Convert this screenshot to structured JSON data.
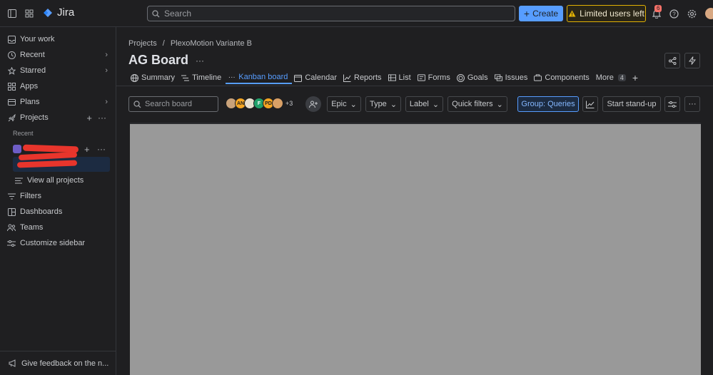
{
  "topbar": {
    "app_name": "Jira",
    "search_placeholder": "Search",
    "create_label": "Create",
    "limited_label": "Limited users left",
    "notification_count": "6"
  },
  "sidebar": {
    "items": [
      {
        "label": "Your work",
        "icon": "inbox-icon"
      },
      {
        "label": "Recent",
        "icon": "clock-icon"
      },
      {
        "label": "Starred",
        "icon": "star-icon"
      },
      {
        "label": "Apps",
        "icon": "apps-icon"
      },
      {
        "label": "Plans",
        "icon": "plans-icon"
      },
      {
        "label": "Projects",
        "icon": "rocket-icon"
      }
    ],
    "recent_heading": "Recent",
    "view_all_projects": "View all projects",
    "filters": "Filters",
    "dashboards": "Dashboards",
    "teams": "Teams",
    "customize": "Customize sidebar",
    "feedback": "Give feedback on the n..."
  },
  "main": {
    "breadcrumb": [
      "Projects",
      "/",
      "PlexoMotion Variante B"
    ],
    "title": "AG Board",
    "tabs": [
      {
        "label": "Summary",
        "icon": "globe-icon"
      },
      {
        "label": "Timeline",
        "icon": "timeline-icon"
      },
      {
        "label": "Kanban board",
        "icon": "dots-icon",
        "active": true
      },
      {
        "label": "Calendar",
        "icon": "calendar-icon"
      },
      {
        "label": "Reports",
        "icon": "chart-icon"
      },
      {
        "label": "List",
        "icon": "list-icon"
      },
      {
        "label": "Forms",
        "icon": "forms-icon"
      },
      {
        "label": "Goals",
        "icon": "goals-icon"
      },
      {
        "label": "Issues",
        "icon": "issues-icon"
      },
      {
        "label": "Components",
        "icon": "components-icon"
      }
    ],
    "more_label": "More",
    "more_count": "4",
    "toolbar": {
      "search_placeholder": "Search board",
      "avatars": [
        {
          "initials": "",
          "color": "#c9a27a"
        },
        {
          "initials": "AN",
          "color": "#f5a623"
        },
        {
          "initials": "",
          "color": "#e8e0d0"
        },
        {
          "initials": "F",
          "color": "#22a06b"
        },
        {
          "initials": "PD",
          "color": "#f5a623"
        },
        {
          "initials": "",
          "color": "#d9a066"
        }
      ],
      "avatars_more": "+3",
      "epic": "Epic",
      "type": "Type",
      "label": "Label",
      "quick_filters": "Quick filters",
      "group": "Group: Queries",
      "standup": "Start stand-up"
    }
  }
}
